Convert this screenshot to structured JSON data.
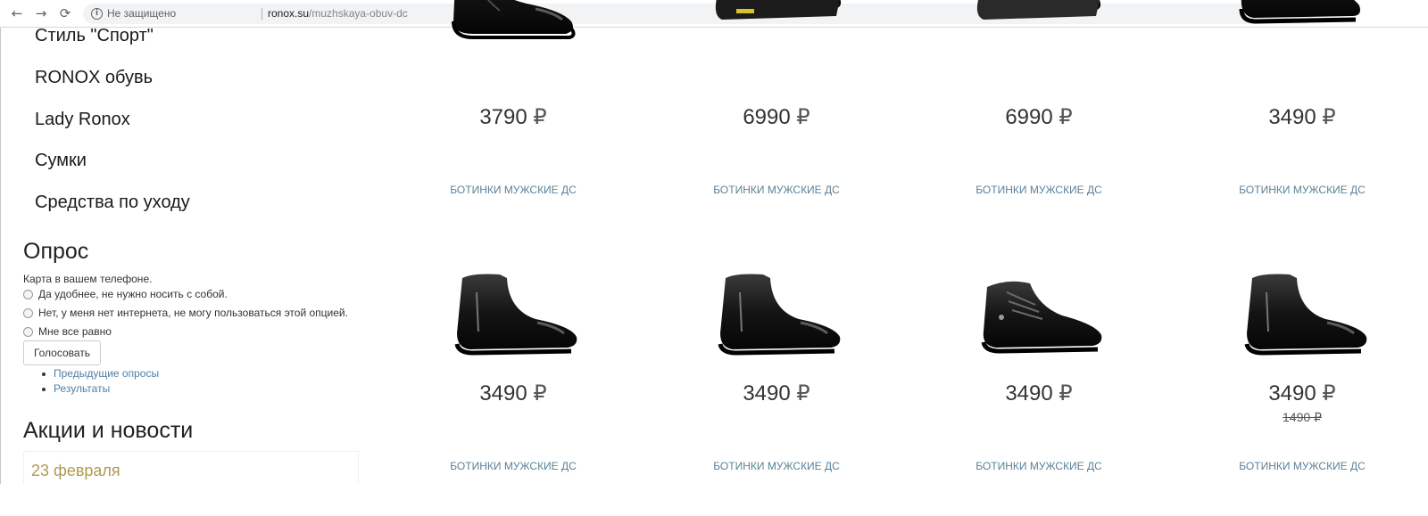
{
  "browser": {
    "security_label": "Не защищено",
    "url_host": "ronox.su",
    "url_path": "/muzhskaya-obuv-dc",
    "back_icon": "←",
    "forward_icon": "→",
    "reload_icon": "⟳",
    "info_icon": "i",
    "star_icon": "☆"
  },
  "sidebar": {
    "categories": [
      {
        "label": "Стиль \"Спорт\""
      },
      {
        "label": "RONOX обувь"
      },
      {
        "label": "Lady Ronox"
      },
      {
        "label": "Сумки"
      },
      {
        "label": "Средства по уходу"
      }
    ],
    "poll": {
      "title": "Опрос",
      "question": "Карта в вашем телефоне.",
      "options": [
        {
          "label": "Да удобнее, не нужно носить с собой."
        },
        {
          "label": "Нет, у меня нет интернета, не могу пользоваться этой опцией."
        },
        {
          "label": "Мне все равно"
        }
      ],
      "vote_label": "Голосовать",
      "links": [
        {
          "label": "Предыдущие опросы"
        },
        {
          "label": "Результаты"
        }
      ]
    },
    "news": {
      "title": "Акции и новости",
      "first_item_date": "23 февраля"
    }
  },
  "products": [
    {
      "price": "3790",
      "currency": "₽",
      "title": "БОТИНКИ МУЖСКИЕ ДС",
      "style": "chelsea"
    },
    {
      "price": "6990",
      "currency": "₽",
      "title": "БОТИНКИ МУЖСКИЕ ДС",
      "style": "sport-teal"
    },
    {
      "price": "6990",
      "currency": "₽",
      "title": "БОТИНКИ МУЖСКИЕ ДС",
      "style": "sport-red"
    },
    {
      "price": "3490",
      "currency": "₽",
      "title": "БОТИНКИ МУЖСКИЕ ДС",
      "style": "laced-boot"
    },
    {
      "price": "3490",
      "currency": "₽",
      "title": "БОТИНКИ МУЖСКИЕ ДС",
      "style": "zip-boot"
    },
    {
      "price": "3490",
      "currency": "₽",
      "title": "БОТИНКИ МУЖСКИЕ ДС",
      "style": "zip-boot"
    },
    {
      "price": "3490",
      "currency": "₽",
      "title": "БОТИНКИ МУЖСКИЕ ДС",
      "style": "laced-low"
    },
    {
      "price": "3490",
      "currency": "₽",
      "old_price": "1490 ₽",
      "title": "БОТИНКИ МУЖСКИЕ ДС",
      "style": "zip-boot"
    }
  ],
  "colors": {
    "link": "#4f7fa8",
    "product_title": "#5b8199",
    "news_date": "#b09a4e",
    "sole_accent_teal": "#2bb3b8",
    "sole_accent_red": "#c8202a"
  }
}
